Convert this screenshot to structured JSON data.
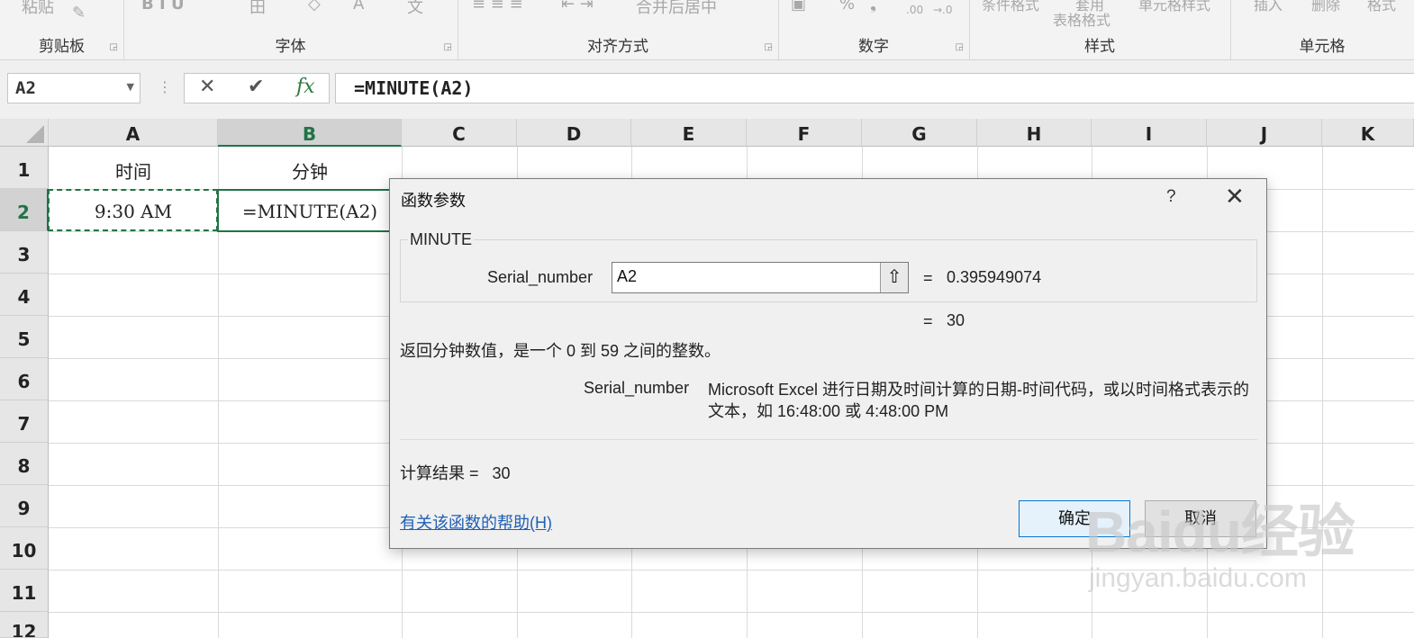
{
  "ribbon": {
    "groups": [
      {
        "label": "剪贴板"
      },
      {
        "label": "字体"
      },
      {
        "label": "对齐方式"
      },
      {
        "label": "数字"
      },
      {
        "label": "样式"
      },
      {
        "label": "单元格"
      }
    ],
    "faded": {
      "paste": "粘贴",
      "font_buttons": "B  I  U",
      "merge_center": "合并后居中",
      "percent": "%",
      "comma": "❟",
      "cond_format": "条件格式",
      "table_format": "表格格式",
      "cell_style": "单元格样式",
      "insert": "插入",
      "delete": "删除",
      "format": "格式",
      "wen": "文",
      "font_a": "A",
      "apply": "套用"
    }
  },
  "formula_bar": {
    "name_box": "A2",
    "formula": "=MINUTE(A2)",
    "fx_label": "fx"
  },
  "sheet": {
    "columns": [
      "A",
      "B",
      "C",
      "D",
      "E",
      "F",
      "G",
      "H",
      "I",
      "J",
      "K"
    ],
    "rows": [
      "1",
      "2",
      "3",
      "4",
      "5",
      "6",
      "7",
      "8",
      "9",
      "10",
      "11",
      "12"
    ],
    "selected_column": "B",
    "selected_row": "2",
    "cells": {
      "A1": "时间",
      "B1": "分钟",
      "A2": "9:30 AM",
      "B2": "=MINUTE(A2)"
    }
  },
  "dialog": {
    "title": "函数参数",
    "help_char": "?",
    "function_name": "MINUTE",
    "arg_label": "Serial_number",
    "arg_value": "A2",
    "arg_evaluated": "0.395949074",
    "func_result": "30",
    "equals": "=",
    "description": "返回分钟数值，是一个 0 到 59 之间的整数。",
    "arg_desc_name": "Serial_number",
    "arg_desc_text": "Microsoft Excel 进行日期及时间计算的日期-时间代码，或以时间格式表示的文本，如 16:48:00 或 4:48:00 PM",
    "calc_label": "计算结果 =",
    "calc_value": "30",
    "help_link": "有关该函数的帮助(H)",
    "ok_label": "确定",
    "cancel_label": "取消"
  },
  "watermark": {
    "logo": "Baidu经验",
    "sub": "jingyan.baidu.com"
  }
}
